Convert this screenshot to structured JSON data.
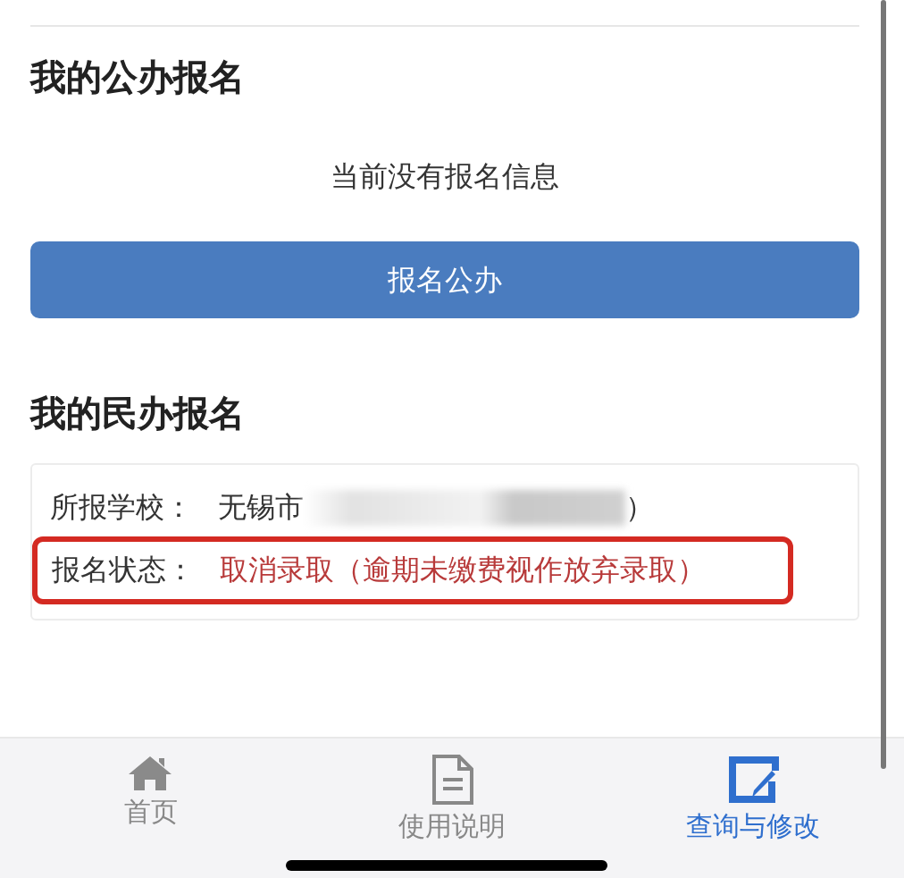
{
  "public_section": {
    "title": "我的公办报名",
    "empty_message": "当前没有报名信息",
    "button": "报名公办"
  },
  "private_section": {
    "title": "我的民办报名",
    "rows": [
      {
        "kind": "school",
        "label": "所报学校：",
        "value_prefix": "无锡市",
        "value_suffix": "）"
      },
      {
        "kind": "status",
        "label": "报名状态：",
        "value": "取消录取（逾期未缴费视作放弃录取）",
        "highlighted": true
      }
    ]
  },
  "tab_bar": [
    {
      "label": "首页",
      "selected": false
    },
    {
      "label": "使用说明",
      "selected": false
    },
    {
      "label": "查询与修改",
      "selected": true
    }
  ]
}
